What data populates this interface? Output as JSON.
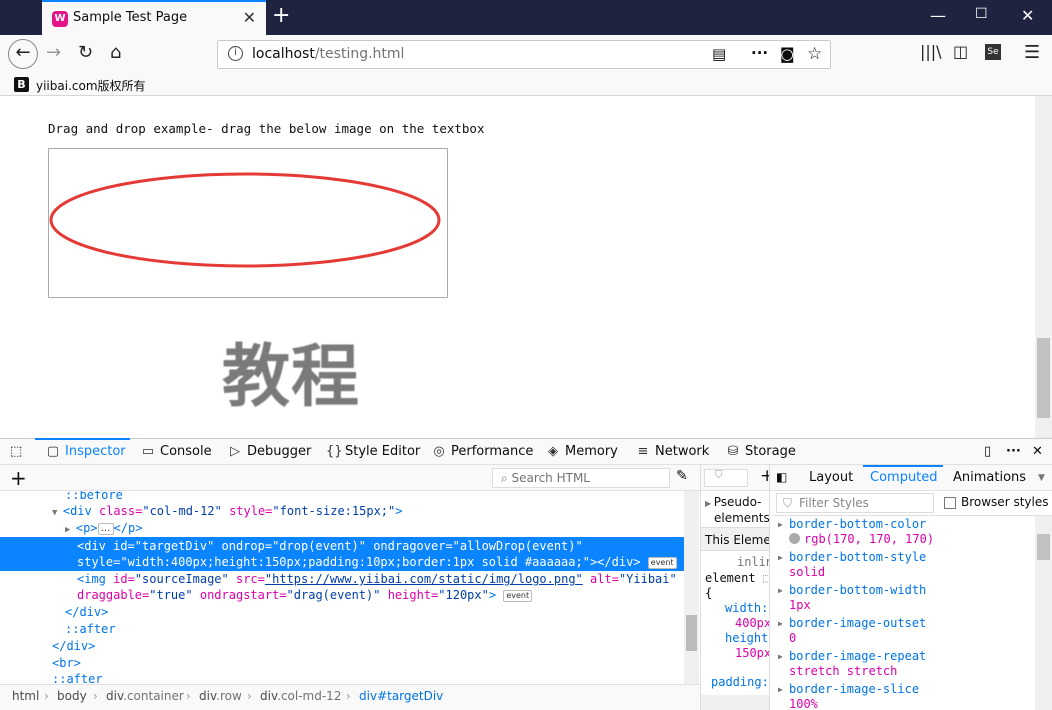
{
  "browser": {
    "tab_title": "Sample Test Page",
    "url_host": "localhost",
    "url_path": "/testing.html",
    "bookmark_label": "yiibai.com版权所有",
    "bookmark_icon_letter": "B"
  },
  "page": {
    "caption": "Drag and drop example- drag the below image on the textbox",
    "logo_text": "教程",
    "ellipse_color": "#e53935"
  },
  "devtools": {
    "tabs": [
      "Inspector",
      "Console",
      "Debugger",
      "Style Editor",
      "Performance",
      "Memory",
      "Network",
      "Storage"
    ],
    "search_placeholder": "Search HTML",
    "markup": {
      "before": "::before",
      "div_open_tag": "<div",
      "div_attr_class": "class=",
      "div_val_class": "\"col-md-12\"",
      "div_attr_style": "style=",
      "div_val_style": "\"font-size:15px;\"",
      "div_close_bracket": ">",
      "p_line": "<p>",
      "p_close": "</p>",
      "target_line1": "<div id=\"targetDiv\" ondrop=\"drop(event)\" ondragover=\"allowDrop(event)\"",
      "target_line2": "style=\"width:400px;height:150px;padding:10px;border:1px solid #aaaaaa;\"></div>",
      "img_line1_tag": "<img",
      "img_attr_id": "id=",
      "img_val_id": "\"sourceImage\"",
      "img_attr_src": "src=",
      "img_val_src": "\"https://www.yiibai.com/static/img/logo.png\"",
      "img_attr_alt": "alt=",
      "img_val_alt": "\"Yiibai\"",
      "img_attr_drag": "draggable=",
      "img_val_drag": "\"true\"",
      "img_attr_ondrag": "ondragstart=",
      "img_val_ondrag": "\"drag(event)\"",
      "img_attr_height": "height=",
      "img_val_height": "\"120px\"",
      "img_close": ">",
      "div_close": "</div>",
      "after": "::after",
      "div_close2": "</div>",
      "br": "<br>",
      "after2": "::after",
      "event_badge": "event"
    },
    "breadcrumb": [
      {
        "tag": "html",
        "cls": ""
      },
      {
        "tag": "body",
        "cls": ""
      },
      {
        "tag": "div",
        "cls": ".container"
      },
      {
        "tag": "div",
        "cls": ".row"
      },
      {
        "tag": "div",
        "cls": ".col-md-12"
      },
      {
        "tag": "div",
        "cls": "#targetDiv"
      }
    ],
    "rule_view": {
      "pseudo": "Pseudo-",
      "pseudo2": "elements",
      "this_element": "This Elemen",
      "inline": "inlin",
      "element": "element",
      "brace": "{",
      "width_prop": "width:",
      "width_val": "400px",
      "height_prop": "height",
      "height_val": "150px",
      "padding_prop": "padding:"
    },
    "side_tabs": [
      "Layout",
      "Computed",
      "Animations"
    ],
    "filter_placeholder": "Filter Styles",
    "browser_styles_label": "Browser styles",
    "computed": [
      {
        "prop": "border-bottom-color",
        "value": "rgb(170, 170, 170)"
      },
      {
        "prop": "border-bottom-style",
        "value": "solid"
      },
      {
        "prop": "border-bottom-width",
        "value": "1px"
      },
      {
        "prop": "border-image-outset",
        "value": "0"
      },
      {
        "prop": "border-image-repeat",
        "value": "stretch stretch"
      },
      {
        "prop": "border-image-slice",
        "value": "100%"
      }
    ]
  }
}
